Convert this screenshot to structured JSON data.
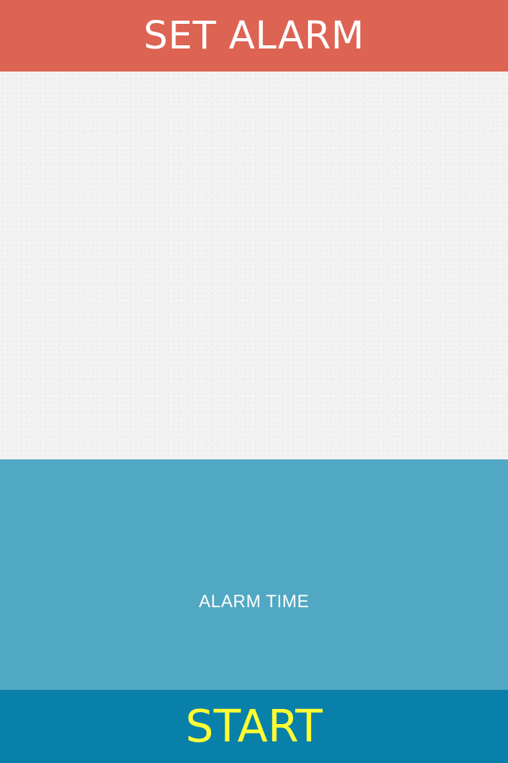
{
  "header": {
    "title": "SET ALARM"
  },
  "alarm_panel": {
    "time_label": "ALARM TIME"
  },
  "footer": {
    "start_label": "START"
  },
  "colors": {
    "header_bg": "#dd6353",
    "content_bg": "#f2f2f2",
    "alarm_panel_bg": "#50a8c3",
    "start_button_bg": "#0880aa",
    "start_text": "#ffff33",
    "title_text": "#ffffff"
  }
}
